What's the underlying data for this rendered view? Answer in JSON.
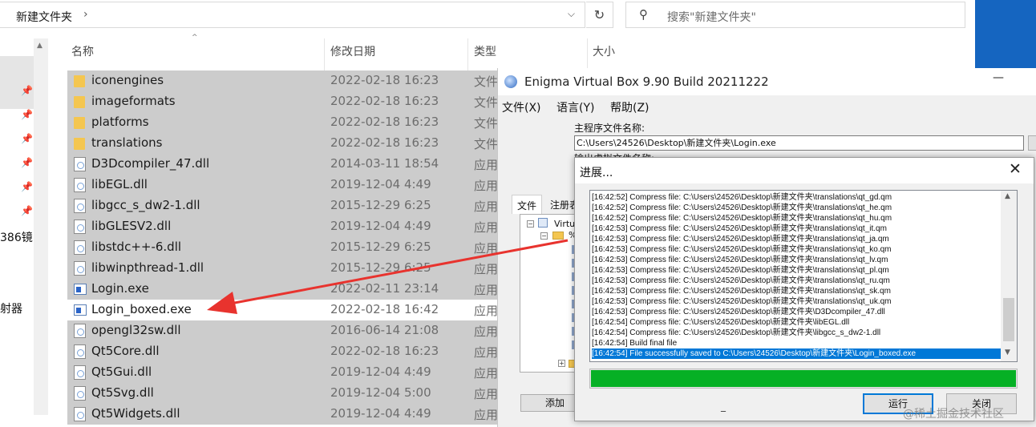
{
  "explorer": {
    "breadcrumb": "新建文件夹",
    "breadcrumb_chevron": "›",
    "dropdown_glyph": "⌵",
    "refresh_glyph": "↻",
    "search_placeholder": "搜索\"新建文件夹\"",
    "search_glyph": "⚲",
    "nav_partial": [
      "386镜",
      "射器"
    ],
    "columns": {
      "name": "名称",
      "date": "修改日期",
      "type": "类型",
      "size": "大小"
    },
    "files": [
      {
        "name": "iconengines",
        "date": "2022-02-18 16:23",
        "type": "文件",
        "icon": "folder-icon"
      },
      {
        "name": "imageformats",
        "date": "2022-02-18 16:23",
        "type": "文件",
        "icon": "folder-icon"
      },
      {
        "name": "platforms",
        "date": "2022-02-18 16:23",
        "type": "文件",
        "icon": "folder-icon"
      },
      {
        "name": "translations",
        "date": "2022-02-18 16:23",
        "type": "文件",
        "icon": "folder-icon"
      },
      {
        "name": "D3Dcompiler_47.dll",
        "date": "2014-03-11 18:54",
        "type": "应用",
        "icon": "dll-icon"
      },
      {
        "name": "libEGL.dll",
        "date": "2019-12-04 4:49",
        "type": "应用",
        "icon": "dll-icon"
      },
      {
        "name": "libgcc_s_dw2-1.dll",
        "date": "2015-12-29 6:25",
        "type": "应用",
        "icon": "dll-icon"
      },
      {
        "name": "libGLESV2.dll",
        "date": "2019-12-04 4:49",
        "type": "应用",
        "icon": "dll-icon"
      },
      {
        "name": "libstdc++-6.dll",
        "date": "2015-12-29 6:25",
        "type": "应用",
        "icon": "dll-icon"
      },
      {
        "name": "libwinpthread-1.dll",
        "date": "2015-12-29 6:25",
        "type": "应用",
        "icon": "dll-icon"
      },
      {
        "name": "Login.exe",
        "date": "2022-02-11 23:14",
        "type": "应用",
        "icon": "exe-icon"
      },
      {
        "name": "Login_boxed.exe",
        "date": "2022-02-18 16:42",
        "type": "应用",
        "icon": "exe-icon"
      },
      {
        "name": "opengl32sw.dll",
        "date": "2016-06-14 21:08",
        "type": "应用",
        "icon": "dll-icon"
      },
      {
        "name": "Qt5Core.dll",
        "date": "2022-02-18 16:23",
        "type": "应用",
        "icon": "dll-icon"
      },
      {
        "name": "Qt5Gui.dll",
        "date": "2019-12-04 4:49",
        "type": "应用",
        "icon": "dll-icon"
      },
      {
        "name": "Qt5Svg.dll",
        "date": "2019-12-04 5:00",
        "type": "应用",
        "icon": "dll-icon"
      },
      {
        "name": "Qt5Widgets.dll",
        "date": "2019-12-04 4:49",
        "type": "应用",
        "icon": "dll-icon"
      }
    ],
    "selected_rows": [
      true,
      true,
      true,
      true,
      true,
      true,
      true,
      true,
      true,
      true,
      true,
      false,
      true,
      true,
      true,
      true,
      true
    ]
  },
  "enigma": {
    "title": "Enigma Virtual Box 9.90 Build 20211222",
    "minimize_glyph": "—",
    "menu": [
      "文件(X)",
      "语言(Y)",
      "帮助(Z)"
    ],
    "main_exe_label": "主程序文件名称:",
    "main_exe_path": "C:\\Users\\24526\\Desktop\\新建文件夹\\Login.exe",
    "output_label": "输出虚拟文件名称:",
    "tabs": [
      "文件",
      "注册表"
    ],
    "tree": [
      "Virtual",
      "%"
    ],
    "add_button": "添加"
  },
  "progress": {
    "title": "进展...",
    "close_glyph": "✕",
    "log": [
      "[16:42:52] Compress file: C:\\Users\\24526\\Desktop\\新建文件夹\\translations\\qt_gd.qm",
      "[16:42:52] Compress file: C:\\Users\\24526\\Desktop\\新建文件夹\\translations\\qt_he.qm",
      "[16:42:52] Compress file: C:\\Users\\24526\\Desktop\\新建文件夹\\translations\\qt_hu.qm",
      "[16:42:53] Compress file: C:\\Users\\24526\\Desktop\\新建文件夹\\translations\\qt_it.qm",
      "[16:42:53] Compress file: C:\\Users\\24526\\Desktop\\新建文件夹\\translations\\qt_ja.qm",
      "[16:42:53] Compress file: C:\\Users\\24526\\Desktop\\新建文件夹\\translations\\qt_ko.qm",
      "[16:42:53] Compress file: C:\\Users\\24526\\Desktop\\新建文件夹\\translations\\qt_lv.qm",
      "[16:42:53] Compress file: C:\\Users\\24526\\Desktop\\新建文件夹\\translations\\qt_pl.qm",
      "[16:42:53] Compress file: C:\\Users\\24526\\Desktop\\新建文件夹\\translations\\qt_ru.qm",
      "[16:42:53] Compress file: C:\\Users\\24526\\Desktop\\新建文件夹\\translations\\qt_sk.qm",
      "[16:42:53] Compress file: C:\\Users\\24526\\Desktop\\新建文件夹\\translations\\qt_uk.qm",
      "[16:42:53] Compress file: C:\\Users\\24526\\Desktop\\新建文件夹\\D3Dcompiler_47.dll",
      "[16:42:54] Compress file: C:\\Users\\24526\\Desktop\\新建文件夹\\libEGL.dll",
      "[16:42:54] Compress file: C:\\Users\\24526\\Desktop\\新建文件夹\\libgcc_s_dw2-1.dll",
      "[16:42:54] Build final file",
      "[16:42:54] File successfully saved to C:\\Users\\24526\\Desktop\\新建文件夹\\Login_boxed.exe"
    ],
    "progress_fraction": 1.0,
    "run_button": "运行",
    "close_button": "关闭",
    "underscore": "_"
  },
  "colors": {
    "progress_green": "#06b025",
    "selection_blue": "#0078d7",
    "arrow_red": "#e8332e",
    "accent_blue": "#1565c0"
  },
  "watermark": "@稀土掘金技术社区"
}
